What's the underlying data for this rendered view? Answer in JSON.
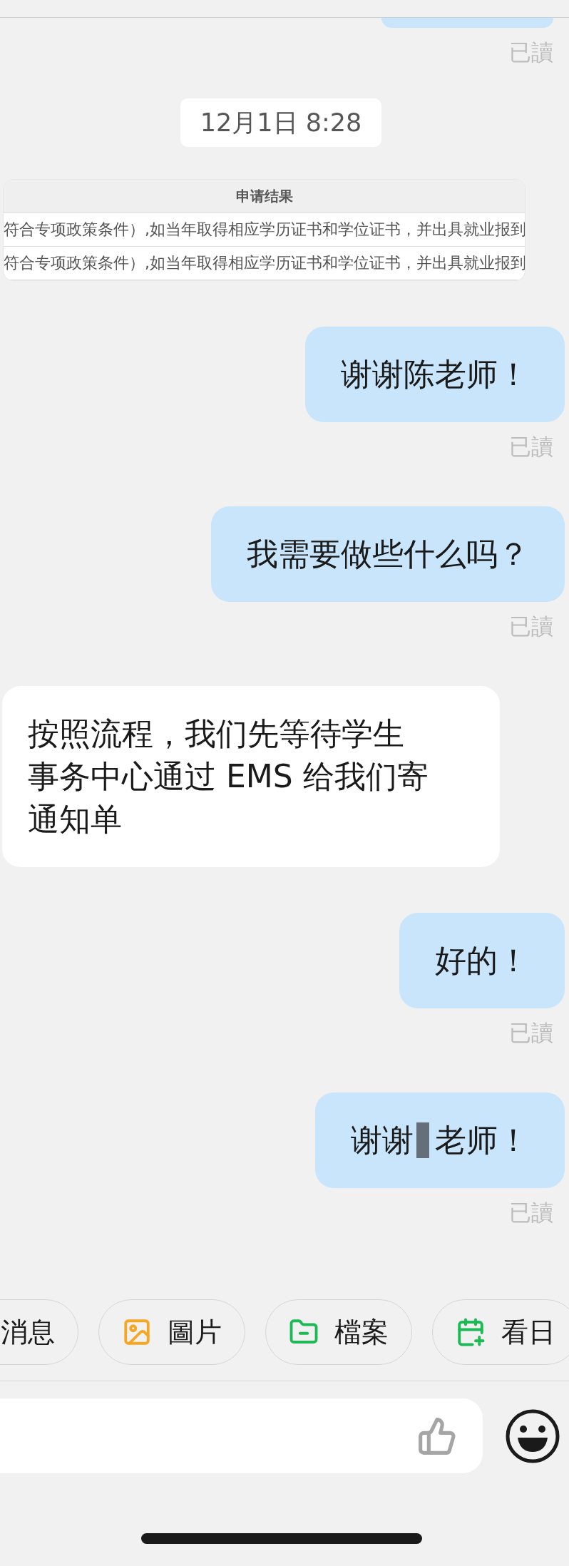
{
  "chat": [
    {
      "kind": "receipt",
      "text": "已讀"
    },
    {
      "kind": "timestamp",
      "text": "12月1日 8:28"
    },
    {
      "kind": "image",
      "header": "申请结果",
      "rows": [
        "符合专项政策条件）,如当年取得相应学历证书和学位证书，并出具就业报到",
        "符合专项政策条件）,如当年取得相应学历证书和学位证书，并出具就业报到"
      ]
    },
    {
      "kind": "sent",
      "parts": [
        "谢谢陈老师！"
      ],
      "redacted": false
    },
    {
      "kind": "receipt",
      "text": "已讀"
    },
    {
      "kind": "sent",
      "parts": [
        "我需要做些什么吗？"
      ],
      "redacted": false
    },
    {
      "kind": "receipt",
      "text": "已讀"
    },
    {
      "kind": "received",
      "lines": [
        "按照流程，我们先等待学生",
        "事务中心通过 EMS 给我们寄",
        "通知单"
      ]
    },
    {
      "kind": "sent",
      "parts": [
        "好的！"
      ],
      "redacted": false
    },
    {
      "kind": "receipt",
      "text": "已讀"
    },
    {
      "kind": "sent",
      "parts": [
        "谢谢",
        "老师！"
      ],
      "redacted": true
    },
    {
      "kind": "receipt",
      "text": "已讀"
    }
  ],
  "quick_actions": [
    {
      "label": "消息",
      "kind": "plain"
    },
    {
      "label": "圖片",
      "kind": "image"
    },
    {
      "label": "檔案",
      "kind": "folder"
    },
    {
      "label": "看日",
      "kind": "calendar"
    }
  ]
}
